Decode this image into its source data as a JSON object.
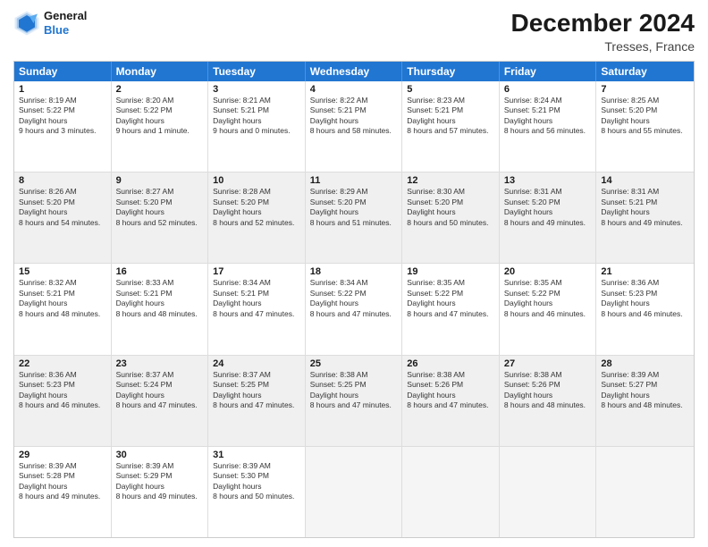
{
  "header": {
    "logo_line1": "General",
    "logo_line2": "Blue",
    "main_title": "December 2024",
    "subtitle": "Tresses, France"
  },
  "calendar": {
    "days_of_week": [
      "Sunday",
      "Monday",
      "Tuesday",
      "Wednesday",
      "Thursday",
      "Friday",
      "Saturday"
    ],
    "weeks": [
      [
        {
          "day": "1",
          "sunrise": "8:19 AM",
          "sunset": "5:22 PM",
          "daylight": "9 hours and 3 minutes."
        },
        {
          "day": "2",
          "sunrise": "8:20 AM",
          "sunset": "5:22 PM",
          "daylight": "9 hours and 1 minute."
        },
        {
          "day": "3",
          "sunrise": "8:21 AM",
          "sunset": "5:21 PM",
          "daylight": "9 hours and 0 minutes."
        },
        {
          "day": "4",
          "sunrise": "8:22 AM",
          "sunset": "5:21 PM",
          "daylight": "8 hours and 58 minutes."
        },
        {
          "day": "5",
          "sunrise": "8:23 AM",
          "sunset": "5:21 PM",
          "daylight": "8 hours and 57 minutes."
        },
        {
          "day": "6",
          "sunrise": "8:24 AM",
          "sunset": "5:21 PM",
          "daylight": "8 hours and 56 minutes."
        },
        {
          "day": "7",
          "sunrise": "8:25 AM",
          "sunset": "5:20 PM",
          "daylight": "8 hours and 55 minutes."
        }
      ],
      [
        {
          "day": "8",
          "sunrise": "8:26 AM",
          "sunset": "5:20 PM",
          "daylight": "8 hours and 54 minutes."
        },
        {
          "day": "9",
          "sunrise": "8:27 AM",
          "sunset": "5:20 PM",
          "daylight": "8 hours and 52 minutes."
        },
        {
          "day": "10",
          "sunrise": "8:28 AM",
          "sunset": "5:20 PM",
          "daylight": "8 hours and 52 minutes."
        },
        {
          "day": "11",
          "sunrise": "8:29 AM",
          "sunset": "5:20 PM",
          "daylight": "8 hours and 51 minutes."
        },
        {
          "day": "12",
          "sunrise": "8:30 AM",
          "sunset": "5:20 PM",
          "daylight": "8 hours and 50 minutes."
        },
        {
          "day": "13",
          "sunrise": "8:31 AM",
          "sunset": "5:20 PM",
          "daylight": "8 hours and 49 minutes."
        },
        {
          "day": "14",
          "sunrise": "8:31 AM",
          "sunset": "5:21 PM",
          "daylight": "8 hours and 49 minutes."
        }
      ],
      [
        {
          "day": "15",
          "sunrise": "8:32 AM",
          "sunset": "5:21 PM",
          "daylight": "8 hours and 48 minutes."
        },
        {
          "day": "16",
          "sunrise": "8:33 AM",
          "sunset": "5:21 PM",
          "daylight": "8 hours and 48 minutes."
        },
        {
          "day": "17",
          "sunrise": "8:34 AM",
          "sunset": "5:21 PM",
          "daylight": "8 hours and 47 minutes."
        },
        {
          "day": "18",
          "sunrise": "8:34 AM",
          "sunset": "5:22 PM",
          "daylight": "8 hours and 47 minutes."
        },
        {
          "day": "19",
          "sunrise": "8:35 AM",
          "sunset": "5:22 PM",
          "daylight": "8 hours and 47 minutes."
        },
        {
          "day": "20",
          "sunrise": "8:35 AM",
          "sunset": "5:22 PM",
          "daylight": "8 hours and 46 minutes."
        },
        {
          "day": "21",
          "sunrise": "8:36 AM",
          "sunset": "5:23 PM",
          "daylight": "8 hours and 46 minutes."
        }
      ],
      [
        {
          "day": "22",
          "sunrise": "8:36 AM",
          "sunset": "5:23 PM",
          "daylight": "8 hours and 46 minutes."
        },
        {
          "day": "23",
          "sunrise": "8:37 AM",
          "sunset": "5:24 PM",
          "daylight": "8 hours and 47 minutes."
        },
        {
          "day": "24",
          "sunrise": "8:37 AM",
          "sunset": "5:25 PM",
          "daylight": "8 hours and 47 minutes."
        },
        {
          "day": "25",
          "sunrise": "8:38 AM",
          "sunset": "5:25 PM",
          "daylight": "8 hours and 47 minutes."
        },
        {
          "day": "26",
          "sunrise": "8:38 AM",
          "sunset": "5:26 PM",
          "daylight": "8 hours and 47 minutes."
        },
        {
          "day": "27",
          "sunrise": "8:38 AM",
          "sunset": "5:26 PM",
          "daylight": "8 hours and 48 minutes."
        },
        {
          "day": "28",
          "sunrise": "8:39 AM",
          "sunset": "5:27 PM",
          "daylight": "8 hours and 48 minutes."
        }
      ],
      [
        {
          "day": "29",
          "sunrise": "8:39 AM",
          "sunset": "5:28 PM",
          "daylight": "8 hours and 49 minutes."
        },
        {
          "day": "30",
          "sunrise": "8:39 AM",
          "sunset": "5:29 PM",
          "daylight": "8 hours and 49 minutes."
        },
        {
          "day": "31",
          "sunrise": "8:39 AM",
          "sunset": "5:30 PM",
          "daylight": "8 hours and 50 minutes."
        },
        null,
        null,
        null,
        null
      ]
    ]
  }
}
